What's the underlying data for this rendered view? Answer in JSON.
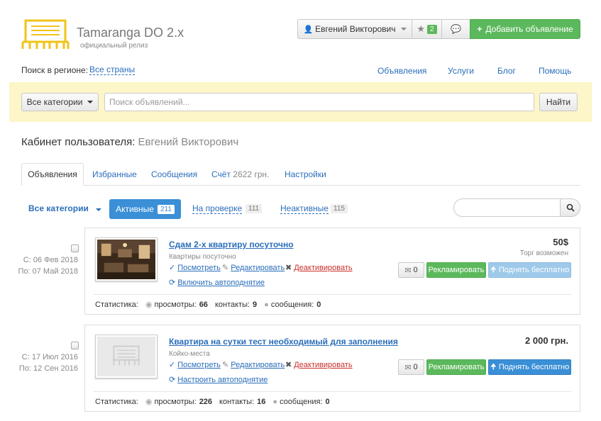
{
  "header": {
    "site_title": "Tamaranga DO 2.x",
    "site_subtitle": "официальный релиз",
    "user_name": "Евгений Викторович",
    "favorites_count": "2",
    "add_button": "Добавить объявление"
  },
  "region": {
    "label": "Поиск в регионе:",
    "value": "Все страны"
  },
  "topnav": [
    "Объявления",
    "Услуги",
    "Блог",
    "Помощь"
  ],
  "search": {
    "category_button": "Все категории",
    "placeholder": "Поиск объявлений...",
    "submit": "Найти"
  },
  "cabinet": {
    "title": "Кабинет пользователя:",
    "user": "Евгений Викторович"
  },
  "tabs": {
    "ads": "Объявления",
    "favorites": "Избранные",
    "messages": "Сообщения",
    "account_label": "Счёт",
    "account_value": "2622 грн.",
    "settings": "Настройки"
  },
  "filters": {
    "all_categories": "Все категории",
    "active_label": "Активные",
    "active_count": "211",
    "review_label": "На проверке",
    "review_count": "111",
    "inactive_label": "Неактивные",
    "inactive_count": "115"
  },
  "listings": [
    {
      "created": "С: 06 Фев 2018",
      "till": "По: 07 Май 2018",
      "title": "Сдам 2-х квартиру посуточно",
      "category": "Квартиры посуточно",
      "price": "50$",
      "price_note": "Торг возможен",
      "view": "Посмотреть",
      "edit": "Редактировать",
      "deactivate": "Деактивировать",
      "autoup": "Включить автоподнятие",
      "messages_count": "0",
      "promote": "Рекламировать",
      "raise": "Поднять бесплатно",
      "stats_label": "Статистика:",
      "views_label": "просмотры:",
      "views": "66",
      "contacts_label": "контакты:",
      "contacts": "9",
      "msgs_label": "сообщения:",
      "msgs": "0"
    },
    {
      "created": "С: 17 Июл 2016",
      "till": "По: 12 Сен 2016",
      "title": "Квартира на сутки тест необходимый для заполнения",
      "category": "Койко-места",
      "price": "2 000 грн.",
      "view": "Посмотреть",
      "edit": "Редактировать",
      "deactivate": "Деактивировать",
      "autoup": "Настроить автоподнятие",
      "messages_count": "0",
      "promote": "Рекламировать",
      "raise": "Поднять бесплатно",
      "stats_label": "Статистика:",
      "views_label": "просмотры:",
      "views": "226",
      "contacts_label": "контакты:",
      "contacts": "16",
      "msgs_label": "сообщения:",
      "msgs": "0"
    }
  ],
  "colors": {
    "brand_yellow": "#f5d94a",
    "link_blue": "#2a6ebb",
    "green": "#5cb85c",
    "active_blue": "#3a8fd6",
    "search_bg": "#fcf6c8",
    "deactivate_red": "#c9302c"
  }
}
